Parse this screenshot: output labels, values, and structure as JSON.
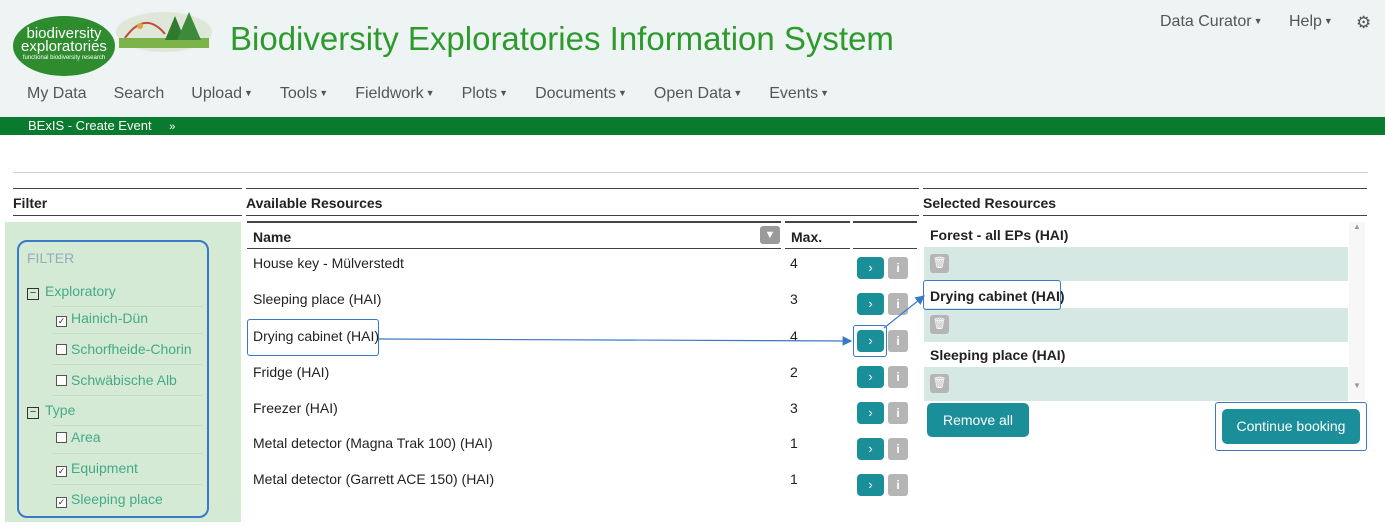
{
  "header": {
    "logo_line1": "biodiversity",
    "logo_line2": "exploratories",
    "logo_sub": "functional biodiversity research",
    "title": "Biodiversity Exploratories Information System",
    "user_menu": "Data Curator",
    "help_menu": "Help",
    "settings_icon": "gear-icon"
  },
  "nav": [
    "My Data",
    "Search",
    "Upload",
    "Tools",
    "Fieldwork",
    "Plots",
    "Documents",
    "Open Data",
    "Events"
  ],
  "breadcrumb": "BExIS - Create Event",
  "columns": {
    "filter": "Filter",
    "available": "Available Resources",
    "selected": "Selected Resources"
  },
  "filter": {
    "title": "FILTER",
    "exploratory_label": "Exploratory",
    "exploratory_items": [
      {
        "label": "Hainich-Dün",
        "checked": true
      },
      {
        "label": "Schorfheide-Chorin",
        "checked": false
      },
      {
        "label": "Schwäbische Alb",
        "checked": false
      }
    ],
    "type_label": "Type",
    "type_items": [
      {
        "label": "Area",
        "checked": false
      },
      {
        "label": "Equipment",
        "checked": true
      },
      {
        "label": "Sleeping place",
        "checked": true
      }
    ]
  },
  "table": {
    "name_header": "Name",
    "max_header": "Max.",
    "rows": [
      {
        "name": "House key - Mülverstedt",
        "max": "4"
      },
      {
        "name": "Sleeping place (HAI)",
        "max": "3"
      },
      {
        "name": "Drying cabinet (HAI)",
        "max": "4"
      },
      {
        "name": "Fridge (HAI)",
        "max": "2"
      },
      {
        "name": "Freezer (HAI)",
        "max": "3"
      },
      {
        "name": "Metal detector (Magna Trak 100) (HAI)",
        "max": "1"
      },
      {
        "name": "Metal detector (Garrett ACE 150) (HAI)",
        "max": "1"
      }
    ]
  },
  "selected": [
    "Forest - all EPs (HAI)",
    "Drying cabinet (HAI)",
    "Sleeping place (HAI)"
  ],
  "buttons": {
    "remove_all": "Remove all",
    "continue": "Continue booking"
  },
  "colors": {
    "brand_green": "#2e9a2e",
    "bar_green": "#0a7a2e",
    "teal": "#1a8f9a",
    "highlight": "#3a78c8"
  }
}
